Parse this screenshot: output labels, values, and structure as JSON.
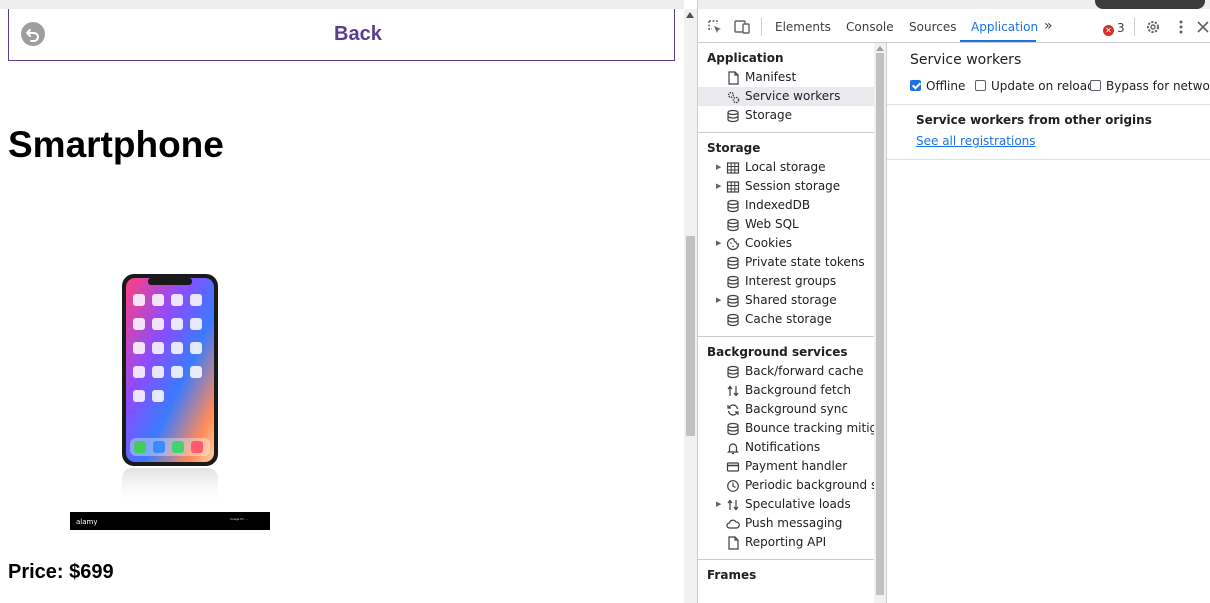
{
  "page": {
    "back_label": "Back",
    "product_title": "Smartphone",
    "price": "Price: $699",
    "watermark_brand": "alamy",
    "watermark_id": "Image ID: ...",
    "colors": {
      "back_text": "#5c3d8f",
      "back_border": "#5c3d8f"
    }
  },
  "devtools": {
    "toolbar": {
      "tabs": [
        {
          "label": "Elements",
          "active": false
        },
        {
          "label": "Console",
          "active": false
        },
        {
          "label": "Sources",
          "active": false
        },
        {
          "label": "Application",
          "active": true
        }
      ],
      "more_tabs_glyph": "»",
      "error_count": "3",
      "icons": [
        "inspect-icon",
        "device-toolbar-icon",
        "settings-icon",
        "more-options-icon",
        "close-icon"
      ]
    },
    "sidebar": {
      "sections": [
        {
          "heading": "Application",
          "items": [
            {
              "label": "Manifest",
              "icon": "document-icon",
              "expandable": false,
              "selected": false
            },
            {
              "label": "Service workers",
              "icon": "gears-icon",
              "expandable": false,
              "selected": true
            },
            {
              "label": "Storage",
              "icon": "database-icon",
              "expandable": false,
              "selected": false
            }
          ]
        },
        {
          "heading": "Storage",
          "items": [
            {
              "label": "Local storage",
              "icon": "table-icon",
              "expandable": true
            },
            {
              "label": "Session storage",
              "icon": "table-icon",
              "expandable": true
            },
            {
              "label": "IndexedDB",
              "icon": "database-icon",
              "expandable": false
            },
            {
              "label": "Web SQL",
              "icon": "database-icon",
              "expandable": false
            },
            {
              "label": "Cookies",
              "icon": "cookie-icon",
              "expandable": true
            },
            {
              "label": "Private state tokens",
              "icon": "database-icon",
              "expandable": false
            },
            {
              "label": "Interest groups",
              "icon": "database-icon",
              "expandable": false
            },
            {
              "label": "Shared storage",
              "icon": "database-icon",
              "expandable": true
            },
            {
              "label": "Cache storage",
              "icon": "database-icon",
              "expandable": false
            }
          ]
        },
        {
          "heading": "Background services",
          "items": [
            {
              "label": "Back/forward cache",
              "icon": "database-icon",
              "expandable": false
            },
            {
              "label": "Background fetch",
              "icon": "sync-arrows-icon",
              "expandable": false
            },
            {
              "label": "Background sync",
              "icon": "refresh-icon",
              "expandable": false
            },
            {
              "label": "Bounce tracking mitigations",
              "icon": "database-icon",
              "expandable": false
            },
            {
              "label": "Notifications",
              "icon": "bell-icon",
              "expandable": false
            },
            {
              "label": "Payment handler",
              "icon": "card-icon",
              "expandable": false
            },
            {
              "label": "Periodic background sync",
              "icon": "clock-icon",
              "expandable": false
            },
            {
              "label": "Speculative loads",
              "icon": "sync-arrows-icon",
              "expandable": true
            },
            {
              "label": "Push messaging",
              "icon": "cloud-icon",
              "expandable": false
            },
            {
              "label": "Reporting API",
              "icon": "document-icon",
              "expandable": false
            }
          ]
        },
        {
          "heading": "Frames",
          "items": []
        }
      ]
    },
    "main": {
      "title": "Service workers",
      "options": [
        {
          "label": "Offline",
          "checked": true
        },
        {
          "label": "Update on reload",
          "checked": false
        },
        {
          "label": "Bypass for network",
          "checked": false
        }
      ],
      "other_origins_heading": "Service workers from other origins",
      "see_all_link": "See all registrations"
    },
    "colors": {
      "accent": "#1a73e8",
      "error": "#d93025",
      "selected_bg": "#e8eaed"
    }
  }
}
